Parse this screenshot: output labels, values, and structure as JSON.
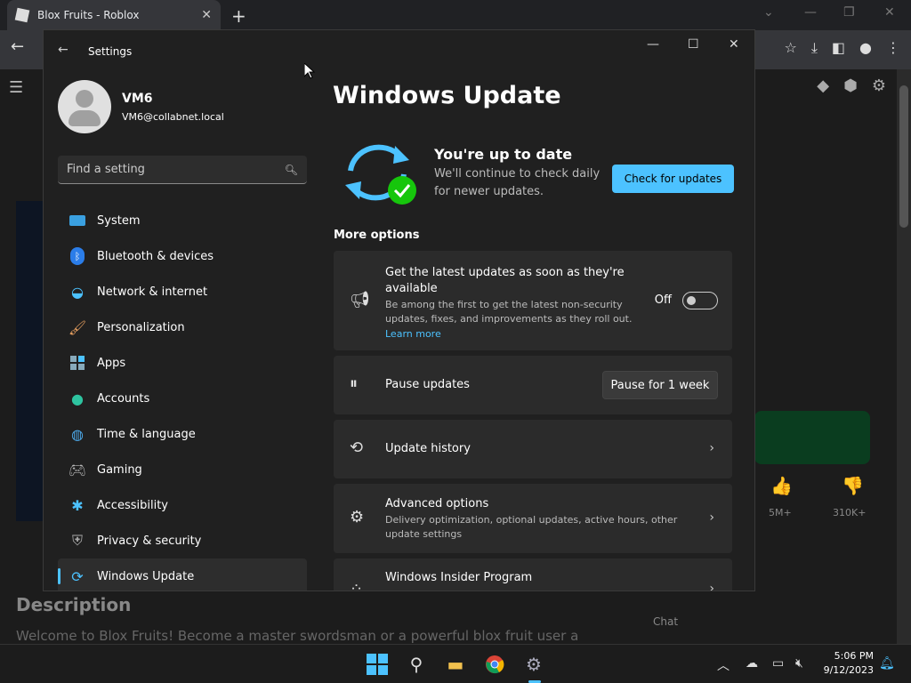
{
  "browser": {
    "tab_title": "Blox Fruits - Roblox",
    "tab_close": "✕",
    "new_tab": "+"
  },
  "page": {
    "description_heading": "Description",
    "description_text": "Welcome to Blox Fruits! Become a master swordsman or a powerful blox fruit user a",
    "chat_label": "Chat",
    "likes": "5M+",
    "dislikes": "310K+"
  },
  "settings": {
    "app_title": "Settings",
    "user": {
      "name": "VM6",
      "email": "VM6@collabnet.local"
    },
    "search_placeholder": "Find a setting",
    "nav": [
      {
        "label": "System",
        "icon": "system-icon"
      },
      {
        "label": "Bluetooth & devices",
        "icon": "bluetooth-icon"
      },
      {
        "label": "Network & internet",
        "icon": "wifi-icon"
      },
      {
        "label": "Personalization",
        "icon": "brush-icon"
      },
      {
        "label": "Apps",
        "icon": "apps-icon"
      },
      {
        "label": "Accounts",
        "icon": "account-icon"
      },
      {
        "label": "Time & language",
        "icon": "globe-clock-icon"
      },
      {
        "label": "Gaming",
        "icon": "gamepad-icon"
      },
      {
        "label": "Accessibility",
        "icon": "accessibility-icon"
      },
      {
        "label": "Privacy & security",
        "icon": "shield-icon"
      },
      {
        "label": "Windows Update",
        "icon": "sync-icon",
        "active": true
      }
    ],
    "main": {
      "heading": "Windows Update",
      "status_title": "You're up to date",
      "status_sub": "We'll continue to check daily for newer updates.",
      "check_button": "Check for updates",
      "more_options": "More options",
      "latest": {
        "title": "Get the latest updates as soon as they're available",
        "desc": "Be among the first to get the latest non-security updates, fixes, and improvements as they roll out.",
        "link": "Learn more",
        "toggle_state": "Off"
      },
      "pause": {
        "title": "Pause updates",
        "button": "Pause for 1 week"
      },
      "history": {
        "title": "Update history"
      },
      "advanced": {
        "title": "Advanced options",
        "desc": "Delivery optimization, optional updates, active hours, other update settings"
      },
      "insider": {
        "title": "Windows Insider Program"
      }
    }
  },
  "taskbar": {
    "time": "5:06 PM",
    "date": "9/12/2023"
  },
  "colors": {
    "accent": "#4cc2ff",
    "success": "#16c60c"
  }
}
